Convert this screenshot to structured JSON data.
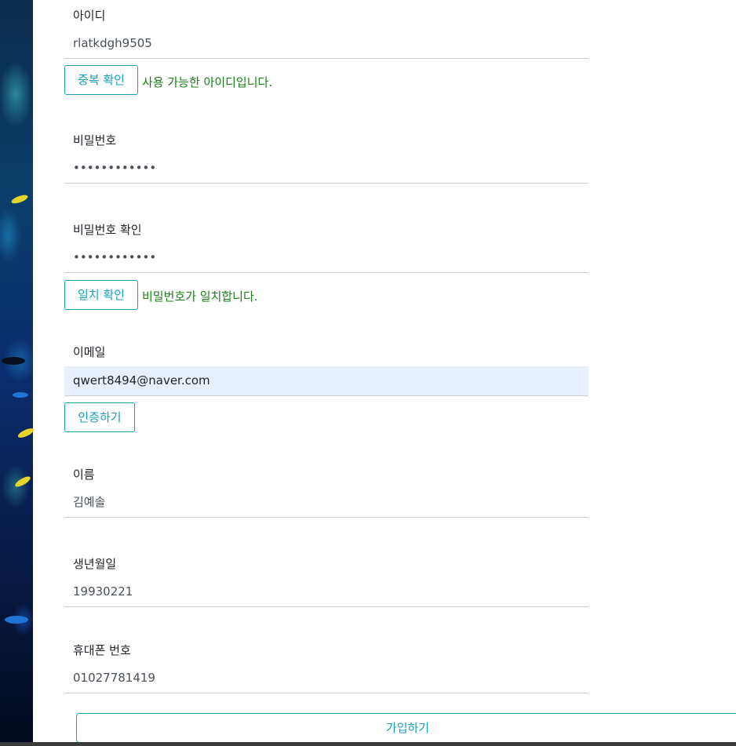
{
  "form": {
    "userid": {
      "label": "아이디",
      "value": "rlatkdgh9505",
      "check_button": "중복 확인",
      "status": "사용 가능한 아이디입니다."
    },
    "password": {
      "label": "비밀번호",
      "value": "••••••••••••"
    },
    "password_confirm": {
      "label": "비밀번호 확인",
      "value": "••••••••••••",
      "check_button": "일치 확인",
      "status": "비밀번호가 일치합니다."
    },
    "email": {
      "label": "이메일",
      "value": "qwert8494@naver.com",
      "verify_button": "인증하기"
    },
    "name": {
      "label": "이름",
      "value": "김예솔"
    },
    "birthdate": {
      "label": "생년월일",
      "value": "19930221"
    },
    "phone": {
      "label": "휴대폰 번호",
      "value": "01027781419"
    },
    "submit_label": "가입하기"
  },
  "colors": {
    "accent": "#17a2b8",
    "success_text": "#198017",
    "autofill_bg": "#e8f0fe"
  }
}
